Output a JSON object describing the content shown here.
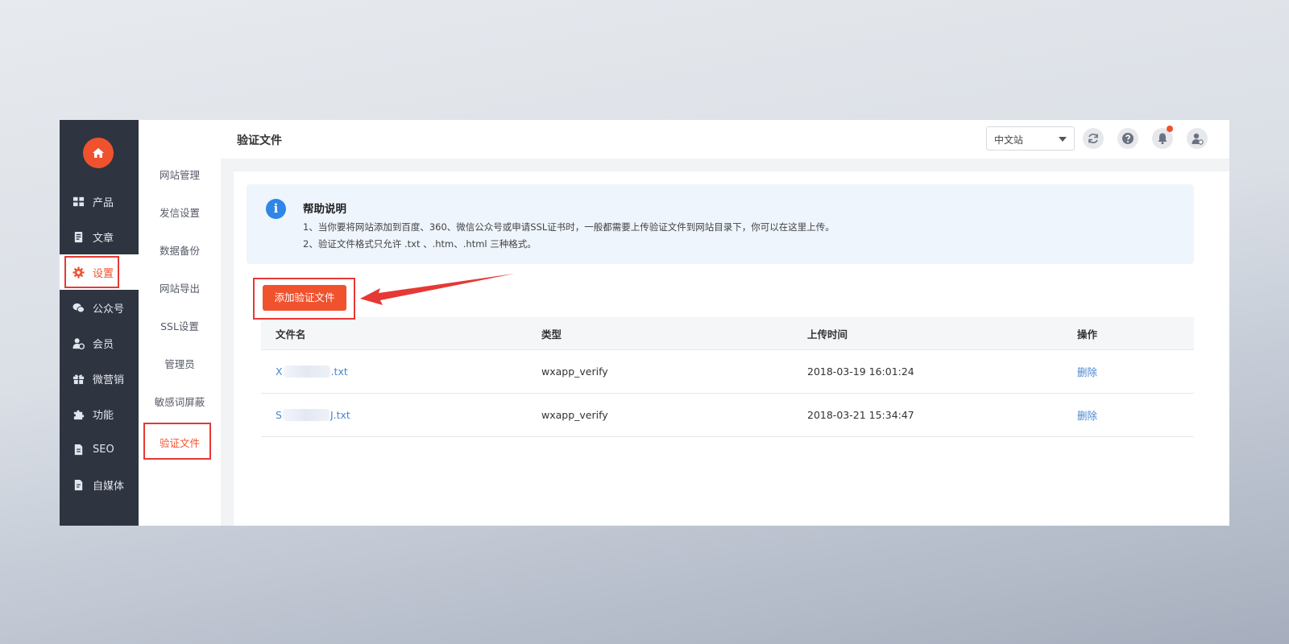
{
  "sidebar": {
    "items": [
      {
        "label": "产品",
        "icon": "grid-icon"
      },
      {
        "label": "文章",
        "icon": "document-icon"
      },
      {
        "label": "设置",
        "icon": "gear-icon",
        "active": true
      },
      {
        "label": "公众号",
        "icon": "wechat-icon"
      },
      {
        "label": "会员",
        "icon": "member-icon"
      },
      {
        "label": "微营销",
        "icon": "gift-icon"
      },
      {
        "label": "功能",
        "icon": "puzzle-icon"
      },
      {
        "label": "SEO",
        "icon": "seo-file-icon"
      },
      {
        "label": "自媒体",
        "icon": "media-file-icon"
      }
    ]
  },
  "subnav": {
    "items": [
      {
        "label": "网站管理"
      },
      {
        "label": "发信设置"
      },
      {
        "label": "数据备份"
      },
      {
        "label": "网站导出"
      },
      {
        "label": "SSL设置"
      },
      {
        "label": "管理员"
      },
      {
        "label": "敏感词屏蔽"
      },
      {
        "label": "验证文件",
        "active": true
      }
    ]
  },
  "header": {
    "title": "验证文件",
    "site_select": "中文站"
  },
  "help": {
    "title": "帮助说明",
    "line1": "1、当你要将网站添加到百度、360、微信公众号或申请SSL证书时，一般都需要上传验证文件到网站目录下，你可以在这里上传。",
    "line2": "2、验证文件格式只允许 .txt 、.htm、.html 三种格式。"
  },
  "add_button": "添加验证文件",
  "table": {
    "columns": [
      "文件名",
      "类型",
      "上传时间",
      "操作"
    ],
    "rows": [
      {
        "name_start": "X",
        "name_end": ".txt",
        "type": "wxapp_verify",
        "time": "2018-03-19 16:01:24",
        "action": "删除"
      },
      {
        "name_start": "S",
        "name_end": "J.txt",
        "type": "wxapp_verify",
        "time": "2018-03-21 15:34:47",
        "action": "删除"
      }
    ]
  },
  "colors": {
    "accent": "#f0522d",
    "sidebar": "#2f3441",
    "link": "#4a86d0",
    "info": "#2e86e8",
    "annotation": "#e53935"
  }
}
